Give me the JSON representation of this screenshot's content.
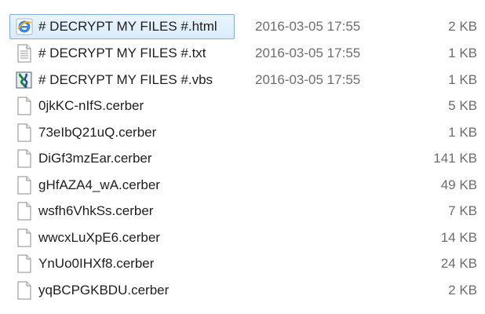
{
  "files": [
    {
      "name": "# DECRYPT MY FILES #.html",
      "date": "2016-03-05 17:55",
      "size": "2 KB",
      "icon": "ie-html-icon",
      "selected": true
    },
    {
      "name": "# DECRYPT MY FILES #.txt",
      "date": "2016-03-05 17:55",
      "size": "1 KB",
      "icon": "text-file-icon",
      "selected": false
    },
    {
      "name": "# DECRYPT MY FILES #.vbs",
      "date": "2016-03-05 17:55",
      "size": "1 KB",
      "icon": "vbs-script-icon",
      "selected": false
    },
    {
      "name": "0jkKC-nIfS.cerber",
      "date": "",
      "size": "5 KB",
      "icon": "blank-file-icon",
      "selected": false
    },
    {
      "name": "73eIbQ21uQ.cerber",
      "date": "",
      "size": "1 KB",
      "icon": "blank-file-icon",
      "selected": false
    },
    {
      "name": "DiGf3mzEar.cerber",
      "date": "",
      "size": "141 KB",
      "icon": "blank-file-icon",
      "selected": false
    },
    {
      "name": "gHfAZA4_wA.cerber",
      "date": "",
      "size": "49 KB",
      "icon": "blank-file-icon",
      "selected": false
    },
    {
      "name": "wsfh6VhkSs.cerber",
      "date": "",
      "size": "7 KB",
      "icon": "blank-file-icon",
      "selected": false
    },
    {
      "name": "wwcxLuXpE6.cerber",
      "date": "",
      "size": "14 KB",
      "icon": "blank-file-icon",
      "selected": false
    },
    {
      "name": "YnUo0IHXf8.cerber",
      "date": "",
      "size": "24 KB",
      "icon": "blank-file-icon",
      "selected": false
    },
    {
      "name": "yqBCPGKBDU.cerber",
      "date": "",
      "size": "2 KB",
      "icon": "blank-file-icon",
      "selected": false
    }
  ]
}
